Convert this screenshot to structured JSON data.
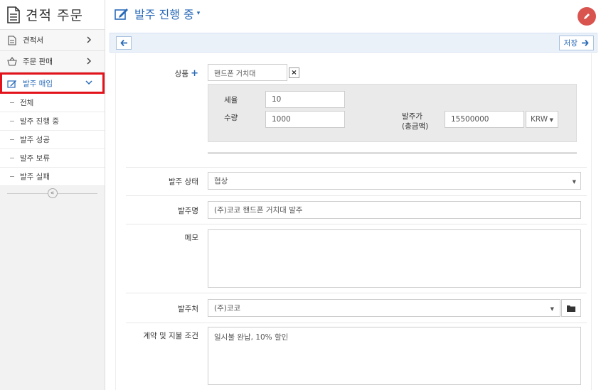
{
  "brand": {
    "title": "견적 주문"
  },
  "sidebar": {
    "items": [
      {
        "label": "견적서"
      },
      {
        "label": "주문 판매"
      },
      {
        "label": "발주 매입"
      }
    ],
    "subitems": [
      {
        "label": "전체"
      },
      {
        "label": "발주 진행 중"
      },
      {
        "label": "발주 성공"
      },
      {
        "label": "발주 보류"
      },
      {
        "label": "발주 실패"
      }
    ],
    "collapse_label": "«"
  },
  "header": {
    "title": "발주 진행 중",
    "caret": "▾"
  },
  "toolbar": {
    "save_label": "저장"
  },
  "form": {
    "product_label": "상품",
    "product_plus": "+",
    "product_value": "핸드폰 거치대",
    "remove_label": "×",
    "tax_label": "세율",
    "tax_value": "10",
    "qty_label": "수량",
    "qty_value": "1000",
    "price_label": "발주가",
    "price_sublabel": "(총금액)",
    "price_value": "15500000",
    "currency_value": "KRW",
    "status_label": "발주 상태",
    "status_value": "협상",
    "name_label": "발주명",
    "name_value": "(주)코코 핸드폰 거치대 발주",
    "memo_label": "메모",
    "memo_value": "",
    "vendor_label": "발주처",
    "vendor_value": "(주)코코",
    "terms_label": "계약 및 지불 조건",
    "terms_value": "일시불 완납, 10% 할인"
  },
  "colors": {
    "accent": "#2a6bb8",
    "active_outline": "#e3131b",
    "fab": "#d9534f"
  }
}
